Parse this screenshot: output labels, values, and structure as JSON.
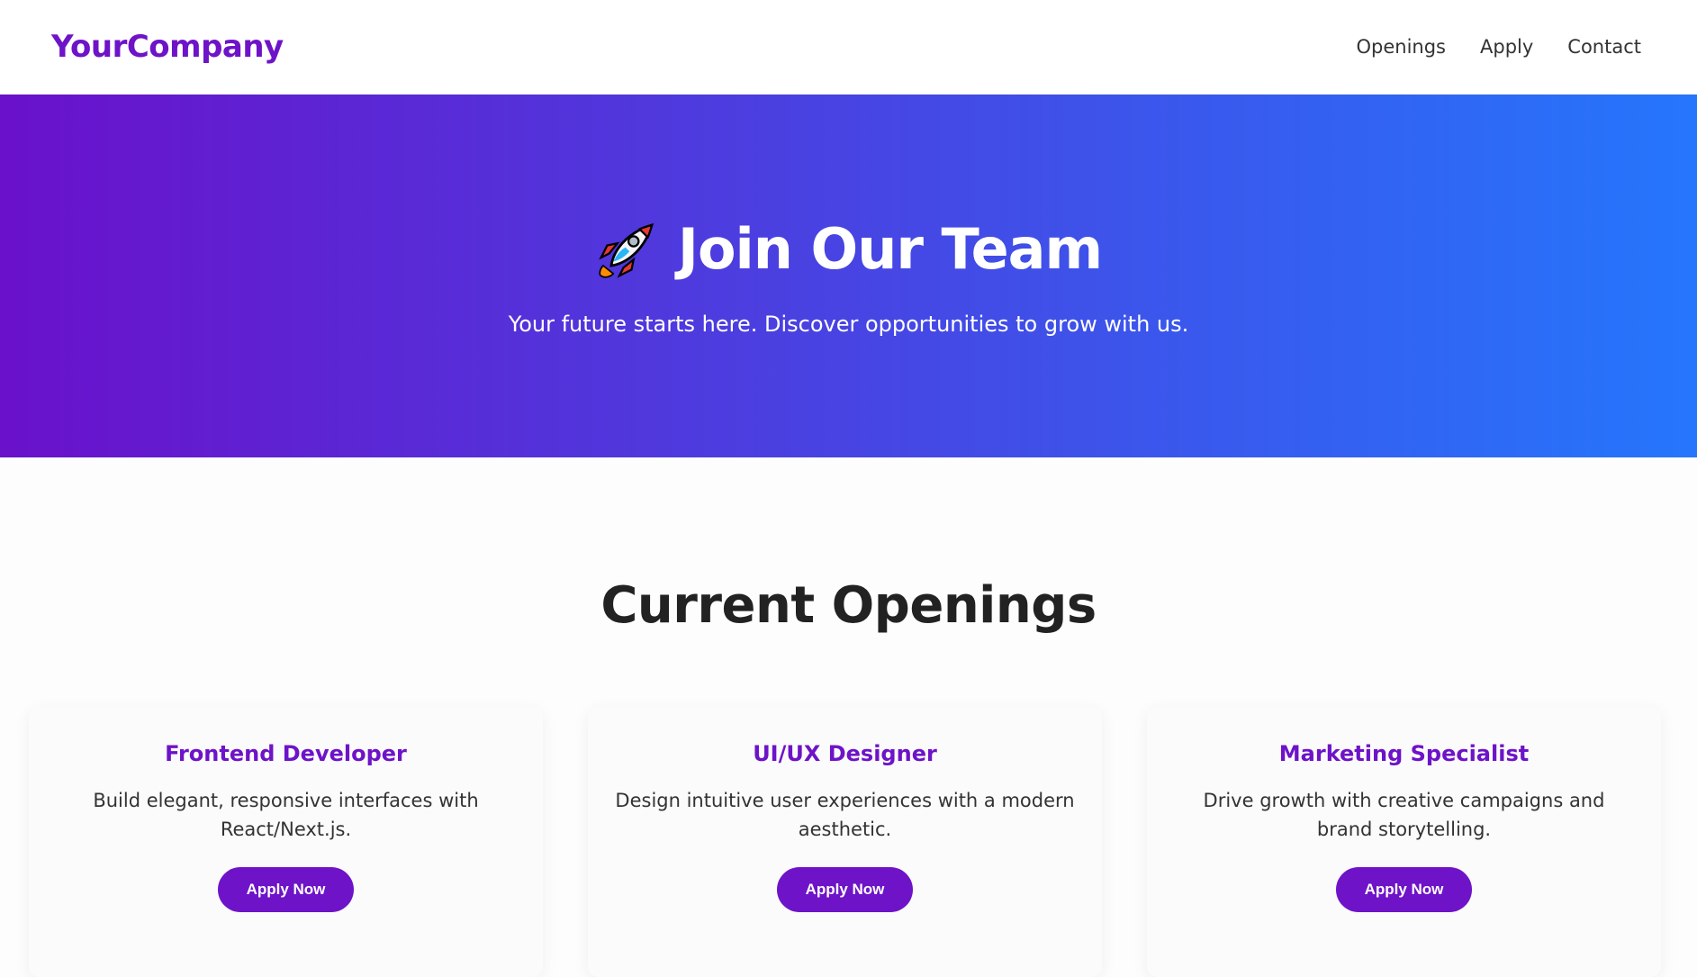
{
  "header": {
    "brand": "YourCompany",
    "nav": [
      {
        "label": "Openings"
      },
      {
        "label": "Apply"
      },
      {
        "label": "Contact"
      }
    ]
  },
  "hero": {
    "title": "Join Our Team",
    "subtitle": "Your future starts here. Discover opportunities to grow with us.",
    "icon": "rocket-icon"
  },
  "openings": {
    "title": "Current Openings",
    "jobs": [
      {
        "title": "Frontend Developer",
        "description": "Build elegant, responsive interfaces with React/Next.js.",
        "button": "Apply Now"
      },
      {
        "title": "UI/UX Designer",
        "description": "Design intuitive user experiences with a modern aesthetic.",
        "button": "Apply Now"
      },
      {
        "title": "Marketing Specialist",
        "description": "Drive growth with creative campaigns and brand storytelling.",
        "button": "Apply Now"
      }
    ]
  },
  "colors": {
    "brand": "#6e13c8",
    "gradient_start": "#6a11cb",
    "gradient_end": "#2576fc"
  }
}
